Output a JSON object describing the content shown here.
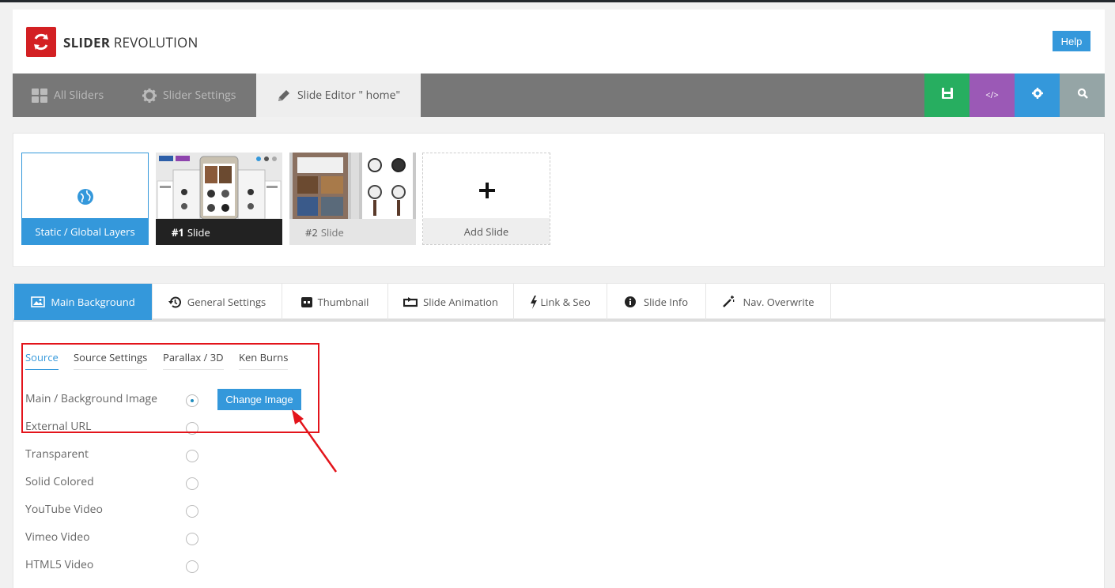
{
  "header": {
    "logo_bold": "SLIDER",
    "logo_light": "REVOLUTION",
    "help_label": "Help"
  },
  "nav": {
    "items": [
      {
        "label": "All Sliders",
        "icon": "grid-icon"
      },
      {
        "label": "Slider Settings",
        "icon": "gear-icon"
      },
      {
        "label": "Slide Editor \" home\"",
        "icon": "pencil-icon"
      }
    ],
    "buttons": [
      {
        "icon": "save-icon",
        "color": "#27ae60"
      },
      {
        "icon": "code-icon",
        "color": "#9b59b6",
        "text": "</>"
      },
      {
        "icon": "settings-icon",
        "color": "#3498db"
      },
      {
        "icon": "search-icon",
        "color": "#95a5a6"
      }
    ]
  },
  "slides": {
    "static_label": "Static / Global Layers",
    "slide1_num": "#1",
    "slide1_label": "Slide",
    "slide2_num": "#2",
    "slide2_label": "Slide",
    "add_label": "Add Slide"
  },
  "tabs": [
    {
      "label": "Main Background",
      "icon": "image-icon"
    },
    {
      "label": "General Settings",
      "icon": "history-icon"
    },
    {
      "label": "Thumbnail",
      "icon": "thumbnail-icon"
    },
    {
      "label": "Slide Animation",
      "icon": "loop-icon"
    },
    {
      "label": "Link & Seo",
      "icon": "bolt-icon"
    },
    {
      "label": "Slide Info",
      "icon": "info-icon"
    },
    {
      "label": "Nav. Overwrite",
      "icon": "wand-icon"
    }
  ],
  "subtabs": [
    "Source",
    "Source Settings",
    "Parallax / 3D",
    "Ken Burns"
  ],
  "options": [
    {
      "label": "Main / Background Image",
      "checked": true
    },
    {
      "label": "External URL",
      "checked": false
    },
    {
      "label": "Transparent",
      "checked": false
    },
    {
      "label": "Solid Colored",
      "checked": false
    },
    {
      "label": "YouTube Video",
      "checked": false
    },
    {
      "label": "Vimeo Video",
      "checked": false
    },
    {
      "label": "HTML5 Video",
      "checked": false
    }
  ],
  "change_image_label": "Change Image",
  "colors": {
    "accent": "#3498db",
    "brand_red": "#d32023",
    "annotation_red": "#e3141b"
  }
}
